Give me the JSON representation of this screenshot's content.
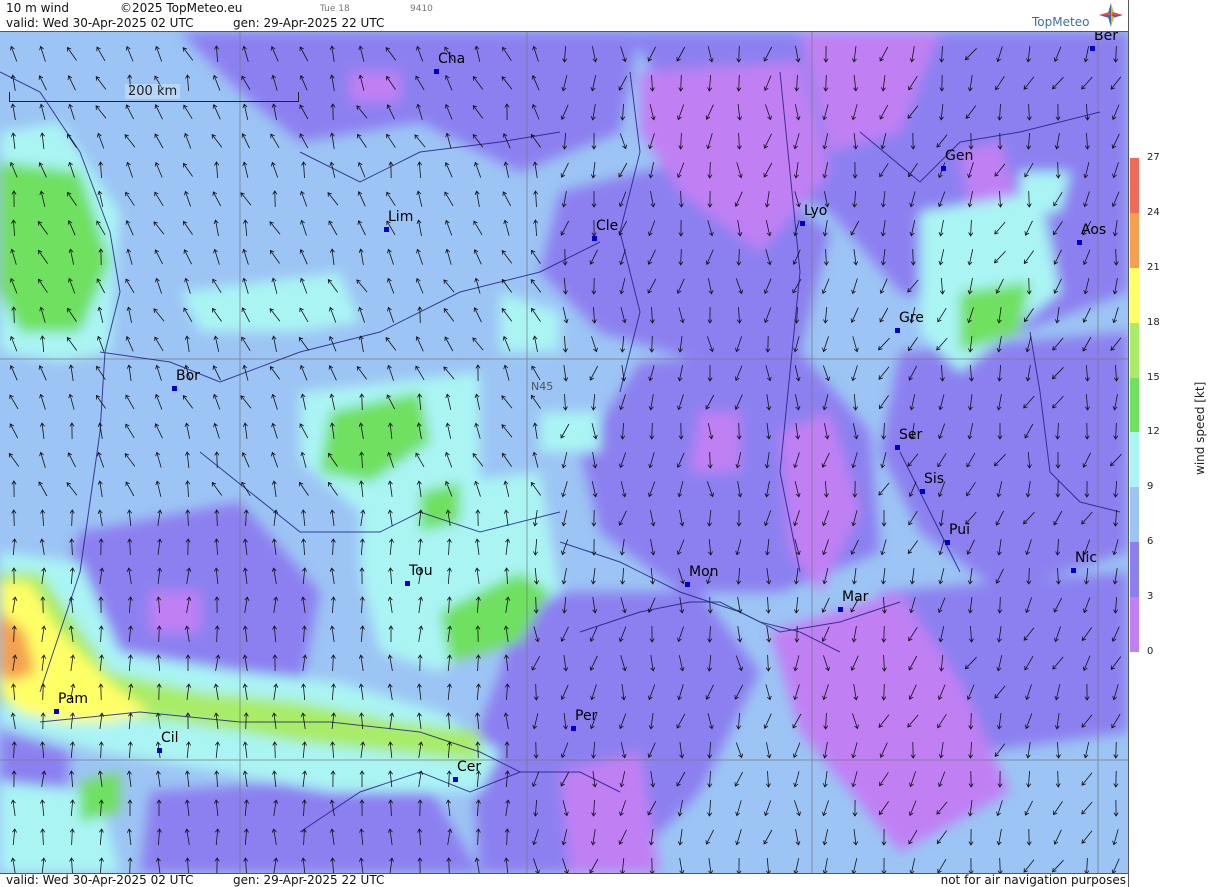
{
  "header": {
    "parameter": "10 m wind",
    "copyright": "©2025 TopMeteo.eu",
    "valid": "valid:  Wed  30-Apr-2025  02 UTC",
    "generated": "gen: 29-Apr-2025 22 UTC",
    "small_tag_1": "Tue 18",
    "small_tag_2": "9410",
    "logo_text": "TopMeteo"
  },
  "footer": {
    "valid": "valid:  Wed  30-Apr-2025  02 UTC",
    "generated": "gen: 29-Apr-2025 22 UTC",
    "disclaimer": "not for air navigation purposes"
  },
  "map": {
    "scale_label": "200 km",
    "latitude_label": "N45",
    "cities": [
      "Cha",
      "Lim",
      "Cle",
      "Lyo",
      "Gen",
      "Ber",
      "Aos",
      "Gre",
      "Bor",
      "Ser",
      "Sis",
      "Pui",
      "Nic",
      "Tou",
      "Mon",
      "Mar",
      "Pam",
      "Per",
      "Cil",
      "Cer"
    ]
  },
  "legend": {
    "title": "wind speed [kt]",
    "ticks": [
      "27",
      "24",
      "21",
      "18",
      "15",
      "12",
      "9",
      "6",
      "3",
      "0"
    ],
    "colors": [
      "#f06a5a",
      "#f4a050",
      "#ffff66",
      "#a8ec68",
      "#70e060",
      "#aaf4f4",
      "#9cc4f4",
      "#8c80f0",
      "#c080f4"
    ]
  },
  "colors": {
    "calm": "#c080f4",
    "light": "#8c80f0",
    "moderate": "#9cc4f4",
    "fresh": "#aaf4f4",
    "strong": "#70e060",
    "very_strong": "#ffff66",
    "gale": "#f4a050",
    "city_marker": "#0000cc"
  }
}
